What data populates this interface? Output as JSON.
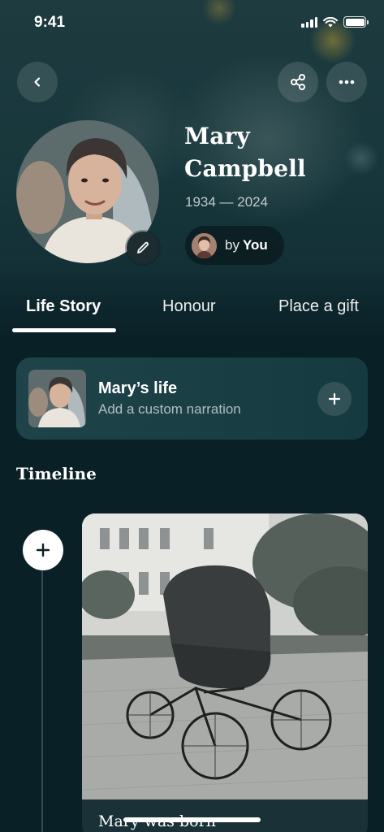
{
  "status_bar": {
    "time": "9:41"
  },
  "profile": {
    "name": "Mary Campbell",
    "dates": "1934 — 2024",
    "by_prefix": "by",
    "by_name": "You"
  },
  "tabs": [
    {
      "label": "Life Story",
      "active": true
    },
    {
      "label": "Honour",
      "active": false
    },
    {
      "label": "Place a gift",
      "active": false
    }
  ],
  "narration_card": {
    "title": "Mary’s life",
    "subtitle": "Add a custom narration"
  },
  "timeline": {
    "heading": "Timeline",
    "events": [
      {
        "title": "Mary was born"
      }
    ]
  },
  "icons": {
    "back": "chevron-left-icon",
    "share": "share-icon",
    "more": "more-horizontal-icon",
    "edit": "pencil-icon",
    "add": "plus-icon"
  },
  "colors": {
    "background": "#0a2027",
    "card": "#1e444a",
    "accent": "#ffffff"
  }
}
